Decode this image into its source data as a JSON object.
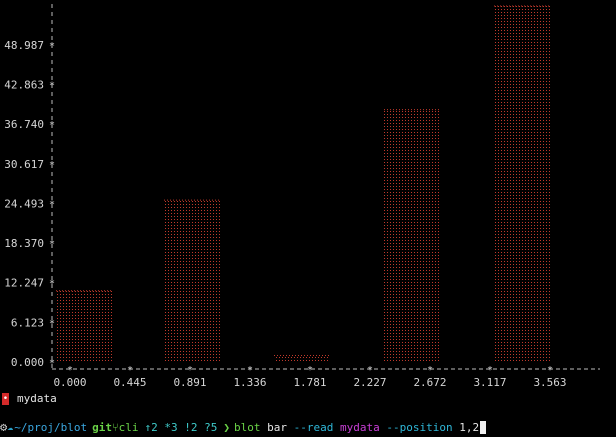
{
  "chart_data": {
    "type": "bar",
    "values": [
      11,
      25,
      1,
      39,
      55
    ],
    "y_ticks": [
      "48.987",
      "42.863",
      "36.740",
      "30.617",
      "24.493",
      "18.370",
      "12.247",
      "6.123",
      "0.000"
    ],
    "x_ticks": [
      "0.000",
      "0.445",
      "0.891",
      "1.336",
      "1.781",
      "2.227",
      "2.672",
      "3.117",
      "3.563"
    ],
    "ylim": [
      0,
      55
    ],
    "grid": false,
    "bar_color": "#c0392b"
  },
  "legend": {
    "label": "mydata",
    "color": "#d42a2a"
  },
  "prompt": {
    "path": "~/proj/blot",
    "git_label": "git",
    "branch": "cli",
    "status": "↑2 *3 !2 ?5",
    "arrow": "❯",
    "command": "blot",
    "subcommand": "bar",
    "flag_read": "--read",
    "read_value": "mydata",
    "flag_position": "--position",
    "position_value": "1,2"
  }
}
